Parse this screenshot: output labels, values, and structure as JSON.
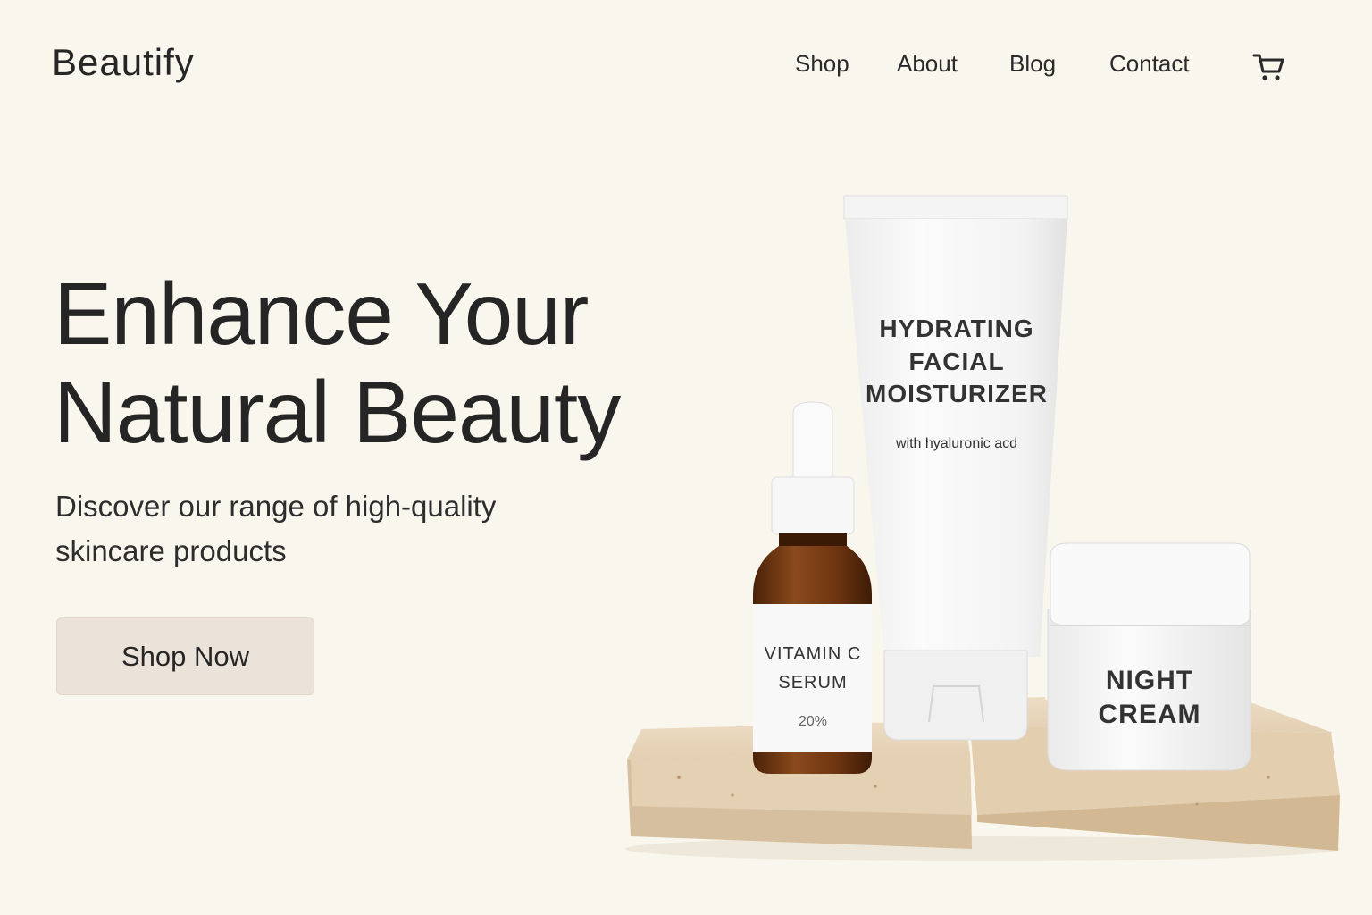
{
  "brand": {
    "name": "Beautify"
  },
  "nav": {
    "items": [
      {
        "label": "Shop"
      },
      {
        "label": "About"
      },
      {
        "label": "Blog"
      },
      {
        "label": "Contact"
      }
    ],
    "cart_icon": "cart-icon"
  },
  "hero": {
    "headline_line1": "Enhance Your",
    "headline_line2": "Natural Beauty",
    "subheading_line1": "Discover our range of high-quality",
    "subheading_line2": "skincare products",
    "cta_label": "Shop Now"
  },
  "products": {
    "moisturizer": {
      "line1": "HYDRATING",
      "line2": "FACIAL",
      "line3": "MOISTURIZER",
      "tagline": "with hyaluronic acd"
    },
    "serum": {
      "line1": "VITAMIN C",
      "line2": "SERUM",
      "strength": "20%"
    },
    "night_cream": {
      "line1": "NIGHT",
      "line2": "CREAM"
    }
  },
  "colors": {
    "background": "#f9f6ed",
    "button": "#ebe3d9",
    "text": "#262626",
    "amber_glass": "#7a3f17",
    "stone": "#e8d6bd"
  }
}
